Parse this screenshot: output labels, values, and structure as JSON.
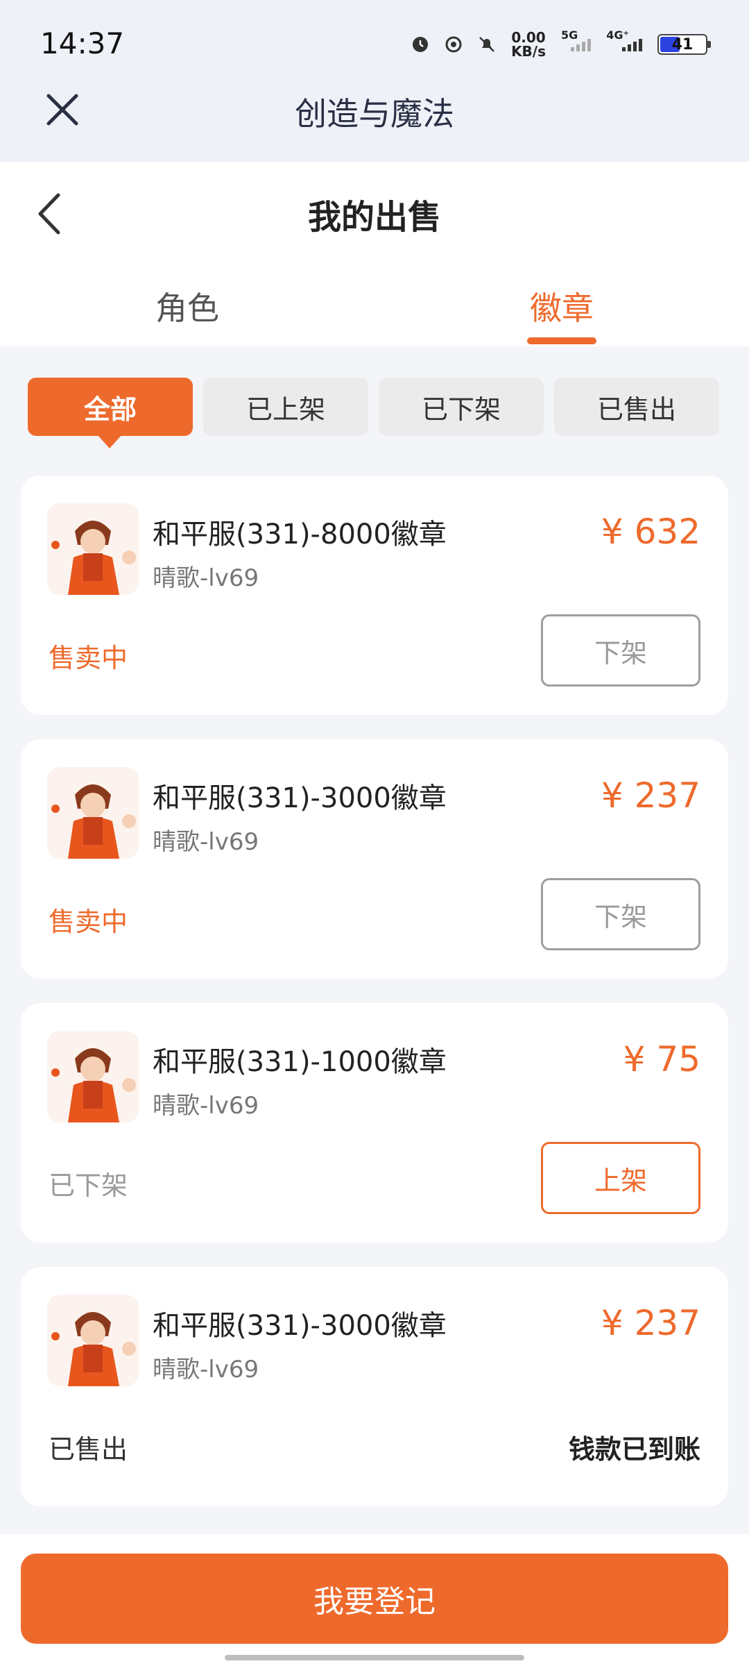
{
  "status_bar": {
    "time": "14:37",
    "net_speed_value": "0.00",
    "net_speed_unit": "KB/s",
    "signal_1": "5G",
    "signal_2": "4G⁺",
    "battery": "41",
    "icons": [
      "alarm-icon",
      "data-saver-icon",
      "mute-icon",
      "signal-5g-icon",
      "signal-4g-icon",
      "battery-icon"
    ]
  },
  "app_header": {
    "title": "创造与魔法",
    "close_icon": "close-icon"
  },
  "page": {
    "title": "我的出售",
    "back_icon": "chevron-left-icon",
    "tabs": [
      {
        "label": "角色",
        "active": false
      },
      {
        "label": "徽章",
        "active": true
      }
    ],
    "filters": [
      {
        "label": "全部",
        "active": true
      },
      {
        "label": "已上架",
        "active": false
      },
      {
        "label": "已下架",
        "active": false
      },
      {
        "label": "已售出",
        "active": false
      }
    ]
  },
  "listings": [
    {
      "title": "和平服(331)-8000徽章",
      "seller": "晴歌-lv69",
      "price": "¥ 632",
      "status": "售卖中",
      "action": "下架",
      "paid_note": ""
    },
    {
      "title": "和平服(331)-3000徽章",
      "seller": "晴歌-lv69",
      "price": "¥ 237",
      "status": "售卖中",
      "action": "下架",
      "paid_note": ""
    },
    {
      "title": "和平服(331)-1000徽章",
      "seller": "晴歌-lv69",
      "price": "¥ 75",
      "status": "已下架",
      "action": "上架",
      "paid_note": ""
    },
    {
      "title": "和平服(331)-3000徽章",
      "seller": "晴歌-lv69",
      "price": "¥ 237",
      "status": "已售出",
      "action": "",
      "paid_note": "钱款已到账"
    }
  ],
  "bottom": {
    "register_label": "我要登记"
  },
  "colors": {
    "accent": "#ee6a2c",
    "background": "#f4f5f9",
    "header_bg": "#eef1f7"
  }
}
